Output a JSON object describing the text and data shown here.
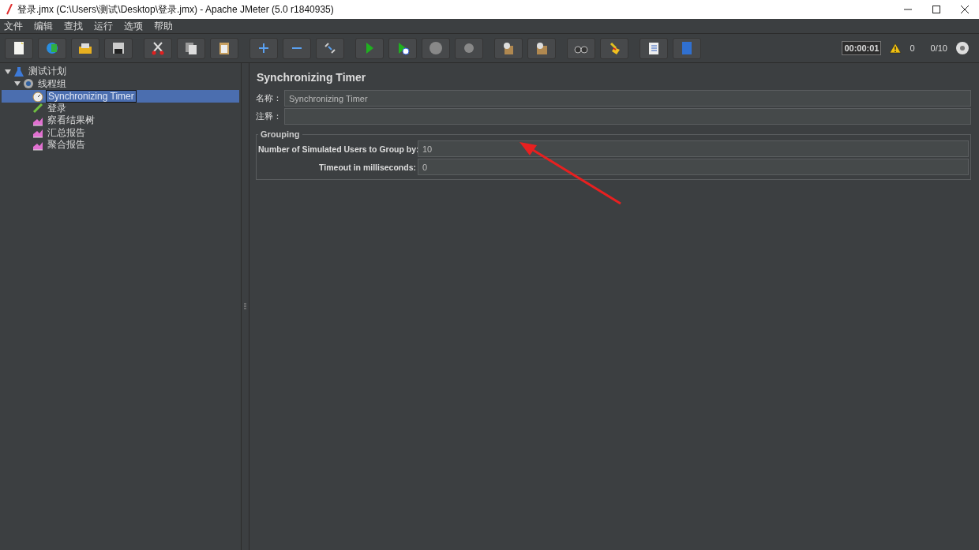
{
  "window": {
    "title": "登录.jmx (C:\\Users\\测试\\Desktop\\登录.jmx) - Apache JMeter (5.0 r1840935)"
  },
  "menu": [
    "文件",
    "编辑",
    "查找",
    "运行",
    "选项",
    "帮助"
  ],
  "status": {
    "timer": "00:00:01",
    "warnings": "0",
    "threads": "0/10"
  },
  "tree": [
    {
      "label": "测试计划",
      "kind": "plan",
      "selected": false,
      "expanded": true,
      "children": [
        {
          "label": "线程组",
          "kind": "thread_group",
          "selected": false,
          "expanded": true,
          "children": [
            {
              "label": "Synchronizing Timer",
              "kind": "timer",
              "selected": true
            },
            {
              "label": "登录",
              "kind": "sampler",
              "selected": false
            },
            {
              "label": "察看结果树",
              "kind": "listener",
              "selected": false
            },
            {
              "label": "汇总报告",
              "kind": "listener",
              "selected": false
            },
            {
              "label": "聚合报告",
              "kind": "listener",
              "selected": false
            }
          ]
        }
      ]
    }
  ],
  "panel": {
    "title": "Synchronizing Timer",
    "name_label": "名称：",
    "name_value": "Synchronizing Timer",
    "comment_label": "注释：",
    "group": {
      "title": "Grouping",
      "fields": [
        {
          "label": "Number of Simulated Users to Group by:",
          "value": "10"
        },
        {
          "label": "Timeout in milliseconds:",
          "value": "0"
        }
      ]
    }
  }
}
